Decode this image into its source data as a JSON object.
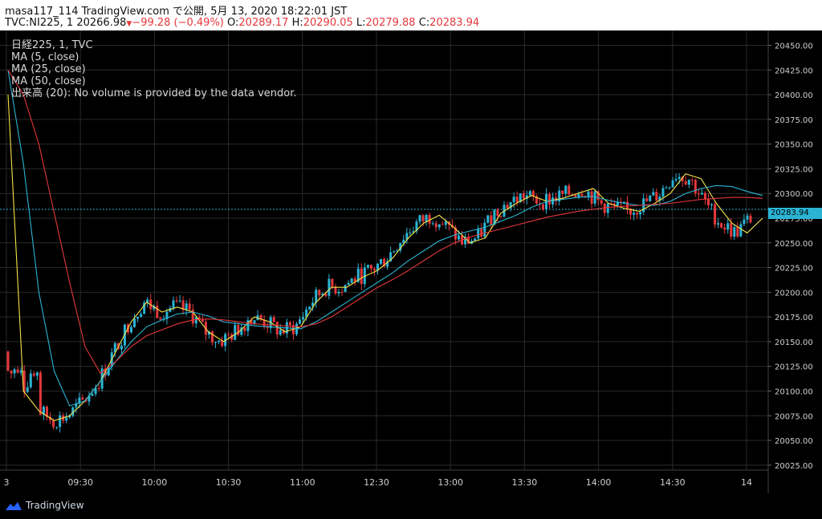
{
  "header": {
    "title": "masa117_114 TradingView.com で公開, 5月 13, 2020 18:22:01 JST",
    "symbol": "TVC:NI225, 1",
    "last": "20266.98",
    "change": "−99.28 (−0.49%)",
    "o_label": "O:",
    "o_value": "20289.17",
    "h_label": "H:",
    "h_value": "20290.05",
    "l_label": "L:",
    "l_value": "20279.88",
    "c_label": "C:",
    "c_value": "20283.94",
    "down_arrow": "▼"
  },
  "legend": {
    "line1": "日経225, 1, TVC",
    "line2": "MA (5, close)",
    "line3": "MA (25, close)",
    "line4": "MA (50, close)",
    "line5": "出来高 (20): No volume is provided by the data vendor."
  },
  "price_tag": "20283.94",
  "footer": {
    "brand": "TradingView"
  },
  "colors": {
    "up": "#2bb4d4",
    "down": "#e5383b",
    "ma5": "#f5e34a",
    "ma25": "#2bb4d4",
    "ma50": "#e5383b",
    "grid": "#2a2a2a",
    "price_line": "#2bb4d4"
  },
  "chart_data": {
    "type": "line",
    "title": "",
    "ylim": [
      20020,
      20465
    ],
    "y_ticks": [
      "20450.00",
      "20425.00",
      "20400.00",
      "20375.00",
      "20350.00",
      "20325.00",
      "20300.00",
      "20275.00",
      "20250.00",
      "20225.00",
      "20200.00",
      "20175.00",
      "20150.00",
      "20125.00",
      "20100.00",
      "20075.00",
      "20050.00",
      "20025.00"
    ],
    "y_tick_values": [
      20450,
      20425,
      20400,
      20375,
      20350,
      20325,
      20300,
      20275,
      20250,
      20225,
      20200,
      20175,
      20150,
      20125,
      20100,
      20075,
      20050,
      20025
    ],
    "x_ticks": [
      "3",
      "09:30",
      "10:00",
      "10:30",
      "11:00",
      "12:30",
      "13:00",
      "13:30",
      "14:00",
      "14:30",
      "14"
    ],
    "current_price": 20283.94,
    "series": [
      {
        "name": "MA (5, close)",
        "values": [
          20400,
          20100,
          20080,
          20070,
          20075,
          20090,
          20110,
          20140,
          20170,
          20190,
          20180,
          20185,
          20180,
          20160,
          20150,
          20160,
          20175,
          20170,
          20160,
          20165,
          20190,
          20205,
          20205,
          20215,
          20222,
          20235,
          20255,
          20270,
          20278,
          20265,
          20250,
          20255,
          20280,
          20290,
          20298,
          20292,
          20295,
          20300,
          20305,
          20290,
          20285,
          20282,
          20290,
          20300,
          20320,
          20315,
          20290,
          20270,
          20260,
          20275
        ]
      },
      {
        "name": "MA (25, close)",
        "values": [
          20425,
          20330,
          20200,
          20120,
          20085,
          20090,
          20110,
          20130,
          20150,
          20165,
          20172,
          20178,
          20180,
          20176,
          20170,
          20168,
          20166,
          20165,
          20164,
          20163,
          20170,
          20180,
          20190,
          20200,
          20210,
          20220,
          20232,
          20242,
          20252,
          20258,
          20262,
          20266,
          20272,
          20278,
          20286,
          20292,
          20294,
          20296,
          20297,
          20293,
          20290,
          20288,
          20288,
          20292,
          20300,
          20305,
          20308,
          20307,
          20302,
          20298
        ]
      },
      {
        "name": "MA (50, close)",
        "values": [
          20425,
          20400,
          20350,
          20280,
          20210,
          20145,
          20118,
          20130,
          20145,
          20156,
          20162,
          20168,
          20172,
          20173,
          20172,
          20170,
          20168,
          20167,
          20166,
          20165,
          20168,
          20175,
          20185,
          20195,
          20205,
          20213,
          20222,
          20232,
          20242,
          20250,
          20256,
          20260,
          20264,
          20268,
          20272,
          20276,
          20279,
          20282,
          20284,
          20286,
          20287,
          20288,
          20289,
          20290,
          20292,
          20294,
          20295,
          20296,
          20296,
          20295
        ]
      }
    ]
  }
}
